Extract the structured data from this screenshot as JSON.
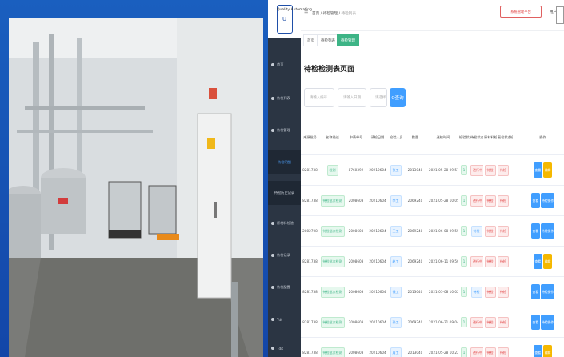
{
  "colors": {
    "accent": "#409eff",
    "green": "#3db486",
    "sidebar": "#2b3543",
    "warn": "#f5b800",
    "danger": "#e04040"
  },
  "logo": {
    "brand": "Quality Automating"
  },
  "topbar": {
    "crumb_home": "首页",
    "crumb_mid": "待检管理",
    "crumb_current": "待检列表",
    "pill": "系统管理平台",
    "user": "用户"
  },
  "tabs": [
    {
      "label": "首页"
    },
    {
      "label": "待检列表"
    },
    {
      "label": "待检管理"
    }
  ],
  "sidebar": {
    "items": [
      {
        "label": "首页"
      },
      {
        "label": "待检列表"
      },
      {
        "label": "待检管理"
      },
      {
        "label": "待检明细"
      },
      {
        "label": "待检历史记录"
      },
      {
        "label": "原材料检验"
      },
      {
        "label": "待检记录"
      },
      {
        "label": "待检配置"
      },
      {
        "label": "Tdt"
      },
      {
        "label": "Tdit"
      }
    ]
  },
  "page": {
    "title": "待检检测表页面"
  },
  "filters": {
    "f1": "请输入编号",
    "f2": "请输入日期",
    "f3": "请选择",
    "search": "Q查询"
  },
  "table": {
    "headers": [
      "来源批号",
      "名称描述",
      "申请单号",
      "请检日期",
      "检验人员",
      "数量",
      "送检时间",
      "检验状态",
      "待检状态",
      "原材料检验",
      "复检状态",
      "检验阶段",
      "操作"
    ],
    "rows": [
      [
        "8281738",
        "检测",
        "8760392",
        "20210604",
        "张工",
        "2013040",
        "2021-05-28 09:57",
        "1",
        "进行中",
        "待检",
        "待检",
        "",
        ""
      ],
      [
        "8281738",
        "待检批次检测",
        "2008603",
        "20210604",
        "李工",
        "2069240",
        "2021-05-28 10:05",
        "1",
        "进行中",
        "待检",
        "待检",
        "",
        "待检操作"
      ],
      [
        "2802708",
        "待检批次检测",
        "2008603",
        "20210604",
        "王工",
        "2069240",
        "2021-06-08 09:55",
        "1",
        "待检",
        "待检",
        "待检",
        "",
        "待检操作"
      ],
      [
        "8281738",
        "待检批次检测",
        "2008603",
        "20210604",
        "赵工",
        "2069240",
        "2021-06-11 09:50",
        "1",
        "进行中",
        "待检",
        "待检",
        "",
        ""
      ],
      [
        "8281738",
        "待检批次检测",
        "2008603",
        "20210604",
        "钱工",
        "2013040",
        "2021-05-08 10:02",
        "1",
        "待检",
        "待检",
        "待检",
        "",
        "待检操作"
      ],
      [
        "8281738",
        "待检批次检测",
        "2008603",
        "20210604",
        "孙工",
        "2069240",
        "2021-06-21 09:04",
        "1",
        "进行中",
        "待检",
        "待检",
        "",
        "待检操作"
      ],
      [
        "8281738",
        "待检批次检测",
        "2008603",
        "20210604",
        "周工",
        "2013040",
        "2021-05-28 10:22",
        "1",
        "进行中",
        "待检",
        "待检",
        "",
        ""
      ]
    ]
  },
  "actions": {
    "view": "查看",
    "edit": "编辑",
    "wide": "待检操作"
  }
}
